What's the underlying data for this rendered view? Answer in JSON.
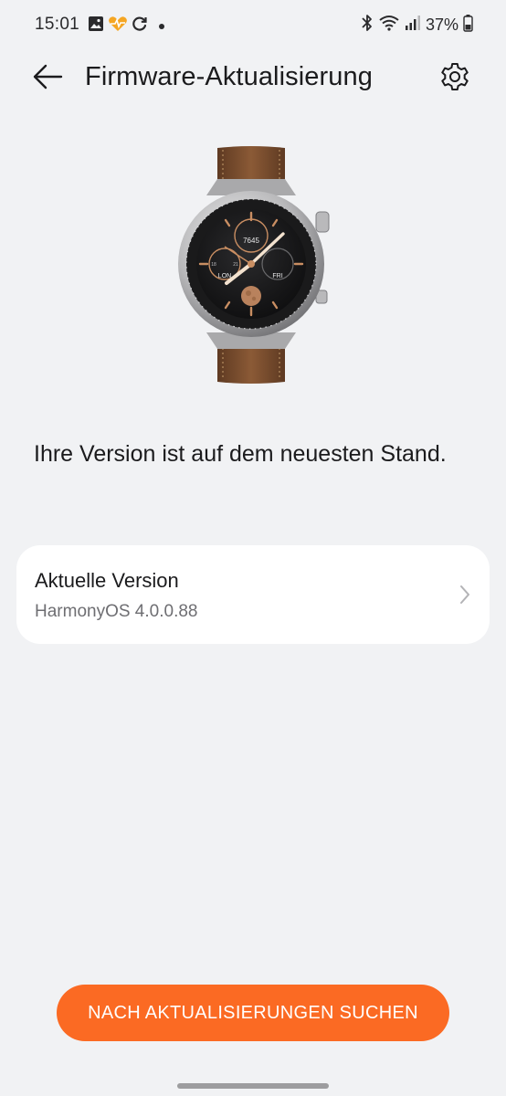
{
  "status_bar": {
    "time": "15:01",
    "left_icons": [
      "gallery-icon",
      "health-app-icon",
      "sync-icon",
      "notification-dot"
    ],
    "right_icons": [
      "bluetooth-icon",
      "wifi-icon",
      "signal-icon",
      "battery-icon"
    ],
    "battery": "37%"
  },
  "header": {
    "title": "Firmware-Aktualisierung",
    "back_icon": "back-arrow-icon",
    "settings_icon": "gear-icon"
  },
  "watch": {
    "image": "smartwatch-image",
    "face": {
      "steps": "7645",
      "left_subdial": "LON",
      "right_subdial": "FRI",
      "tick_left": "18",
      "tick_right": "21"
    }
  },
  "main": {
    "status_message": "Ihre Version ist auf dem neuesten Stand."
  },
  "version_card": {
    "label": "Aktuelle Version",
    "value": "HarmonyOS 4.0.0.88",
    "chevron_icon": "chevron-right-icon"
  },
  "footer": {
    "check_button_label": "NACH AKTUALISIERUNGEN SUCHEN"
  },
  "colors": {
    "accent": "#fb6a23",
    "background": "#f1f2f4",
    "card": "#ffffff",
    "secondary_text": "#6e6e72"
  }
}
